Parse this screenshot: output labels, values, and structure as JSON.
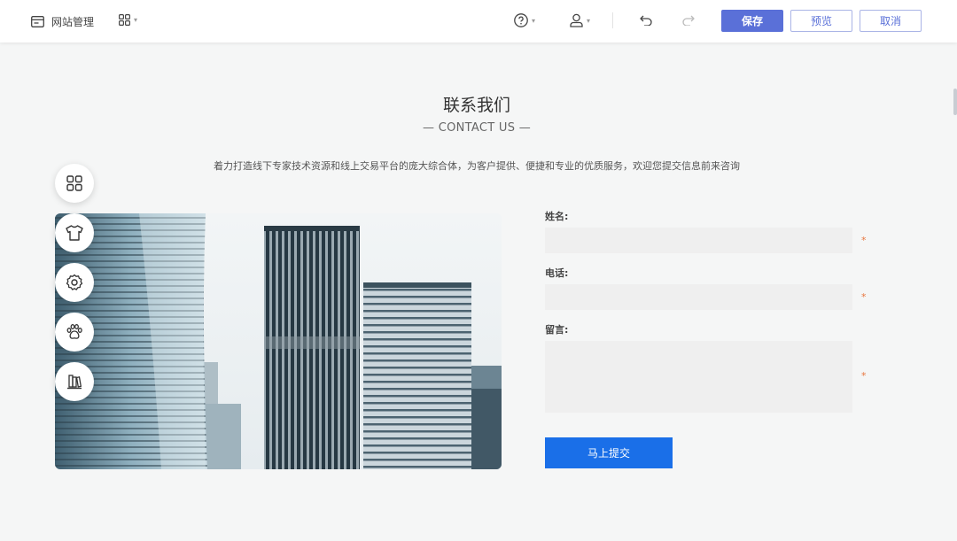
{
  "topbar": {
    "site_manage_label": "网站管理",
    "save_label": "保存",
    "preview_label": "预览",
    "cancel_label": "取消"
  },
  "section": {
    "title": "联系我们",
    "subtitle": "— CONTACT US —",
    "description": "着力打造线下专家技术资源和线上交易平台的庞大综合体，为客户提供、便捷和专业的优质服务，欢迎您提交信息前来咨询"
  },
  "form": {
    "name_label": "姓名:",
    "phone_label": "电话:",
    "message_label": "留言:",
    "required_mark": "*",
    "submit_label": "马上提交"
  },
  "tools": [
    "grid-icon",
    "shirt-icon",
    "settings-icon",
    "paw-icon",
    "books-icon"
  ],
  "colors": {
    "primary": "#5a70d8",
    "submit": "#1a6fe8",
    "required": "#e8763f",
    "background": "#f5f6f6"
  }
}
